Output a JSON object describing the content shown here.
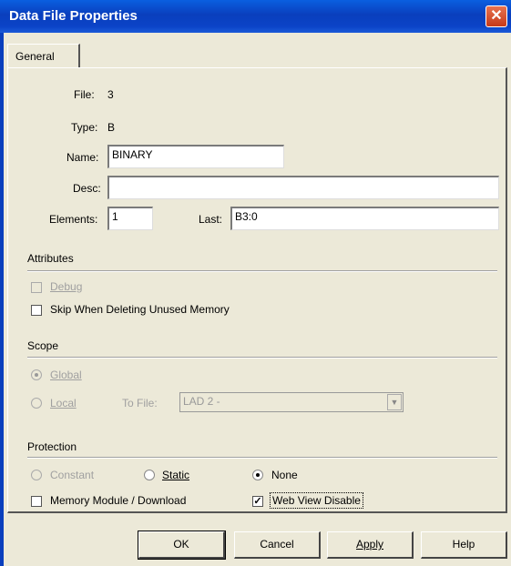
{
  "window": {
    "title": "Data File Properties",
    "close_glyph": "✕"
  },
  "tabs": [
    {
      "label": "General"
    }
  ],
  "fields": {
    "file_label": "File:",
    "file_value": "3",
    "type_label": "Type:",
    "type_value": "B",
    "name_label": "Name:",
    "name_value": "BINARY",
    "desc_label": "Desc:",
    "desc_value": "",
    "elements_label": "Elements:",
    "elements_value": "1",
    "last_label": "Last:",
    "last_value": "B3:0"
  },
  "attributes": {
    "heading": "Attributes",
    "debug": {
      "label": "Debug",
      "checked": false,
      "enabled": false
    },
    "skip": {
      "label": "Skip When Deleting Unused Memory",
      "checked": false,
      "enabled": true
    }
  },
  "scope": {
    "heading": "Scope",
    "global_label": "Global",
    "local_label": "Local",
    "selected": "Global",
    "to_file_label": "To File:",
    "to_file_value": "LAD 2 -"
  },
  "protection": {
    "heading": "Protection",
    "constant_label": "Constant",
    "static_label": "Static",
    "none_label": "None",
    "selected": "None",
    "memory_module_label": "Memory Module / Download",
    "memory_module_checked": false,
    "web_view_label": "Web View Disable",
    "web_view_checked": true
  },
  "buttons": {
    "ok": "OK",
    "cancel": "Cancel",
    "apply": "Apply",
    "help": "Help"
  },
  "colors": {
    "titlebar": "#0a3fbd",
    "dialog_bg": "#ece9d8",
    "close": "#c6391a"
  }
}
